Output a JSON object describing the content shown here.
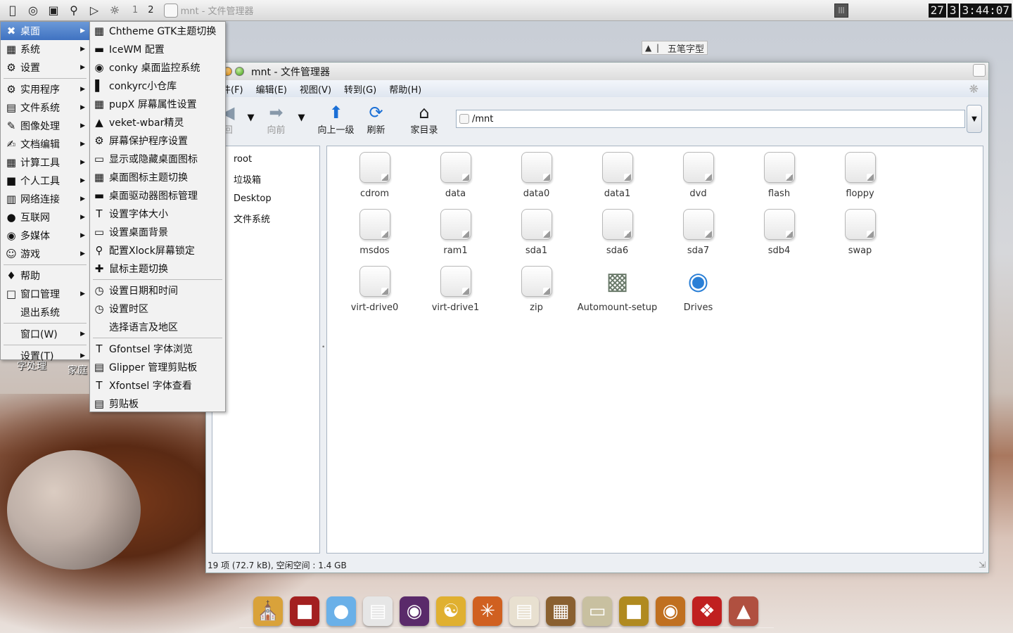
{
  "topbar": {
    "workspaces": [
      "1",
      "2"
    ],
    "task_title": "mnt - 文件管理器",
    "clock": {
      "date": "27",
      "month": "3",
      "time": "3:44:07"
    }
  },
  "ime": {
    "label": "五笔字型"
  },
  "start_menu": {
    "items": [
      {
        "label": "桌面",
        "icon": "desktop-icon",
        "submenu": true,
        "selected": true
      },
      {
        "label": "系统",
        "icon": "system-icon",
        "submenu": true
      },
      {
        "label": "设置",
        "icon": "settings-icon",
        "submenu": true
      },
      {
        "label": "实用程序",
        "icon": "utilities-icon",
        "submenu": true
      },
      {
        "label": "文件系统",
        "icon": "filesystem-icon",
        "submenu": true
      },
      {
        "label": "图像处理",
        "icon": "image-icon",
        "submenu": true
      },
      {
        "label": "文档编辑",
        "icon": "document-icon",
        "submenu": true
      },
      {
        "label": "计算工具",
        "icon": "calc-icon",
        "submenu": true
      },
      {
        "label": "个人工具",
        "icon": "personal-icon",
        "submenu": true
      },
      {
        "label": "网络连接",
        "icon": "network-icon",
        "submenu": true
      },
      {
        "label": "互联网",
        "icon": "internet-icon",
        "submenu": true
      },
      {
        "label": "多媒体",
        "icon": "multimedia-icon",
        "submenu": true
      },
      {
        "label": "游戏",
        "icon": "game-icon",
        "submenu": true
      },
      {
        "label": "帮助",
        "icon": "help-icon",
        "submenu": false
      },
      {
        "label": "窗口管理",
        "icon": "window-icon",
        "submenu": true
      },
      {
        "label": "退出系统",
        "icon": "",
        "submenu": false
      },
      {
        "label": "窗口(W)",
        "icon": "",
        "submenu": true
      },
      {
        "label": "设置(T)",
        "icon": "",
        "submenu": true
      }
    ]
  },
  "desktop_submenu": {
    "items": [
      {
        "label": "Chtheme  GTK主题切换",
        "icon": "theme-icon"
      },
      {
        "label": "IceWM 配置",
        "icon": "icewm-icon"
      },
      {
        "label": "conky 桌面监控系统",
        "icon": "conky-icon"
      },
      {
        "label": "conkyrc小仓库",
        "icon": "chart-icon"
      },
      {
        "label": "pupX 屏幕属性设置",
        "icon": "screen-settings-icon"
      },
      {
        "label": "veket-wbar精灵",
        "icon": "wbar-icon"
      },
      {
        "label": "屏幕保护程序设置",
        "icon": "screensaver-icon"
      },
      {
        "label": "显示或隐藏桌面图标",
        "icon": "monitor-icon"
      },
      {
        "label": "桌面图标主题切换",
        "icon": "icon-theme-icon"
      },
      {
        "label": "桌面驱动器图标管理",
        "icon": "drive-icon"
      },
      {
        "label": "设置字体大小",
        "icon": "font-icon"
      },
      {
        "label": "设置桌面背景",
        "icon": "wallpaper-icon"
      },
      {
        "label": "配置Xlock屏幕锁定",
        "icon": "lock-search-icon"
      },
      {
        "label": "鼠标主题切换",
        "icon": "mouse-theme-icon"
      },
      {
        "label": "设置日期和时间",
        "icon": "clock-icon"
      },
      {
        "label": "设置时区",
        "icon": "clock-icon"
      },
      {
        "label": "选择语言及地区",
        "icon": ""
      },
      {
        "label": "Gfontsel 字体浏览",
        "icon": "font-icon"
      },
      {
        "label": "Glipper 管理剪贴板",
        "icon": "clipboard-icon"
      },
      {
        "label": "Xfontsel 字体查看",
        "icon": "font-icon"
      },
      {
        "label": "剪贴板",
        "icon": "clipboard-icon"
      }
    ]
  },
  "desktop_labels": {
    "word": "字处理",
    "home": "家庭"
  },
  "file_manager": {
    "title": "mnt - 文件管理器",
    "menu": [
      "件(F)",
      "编辑(E)",
      "视图(V)",
      "转到(G)",
      "帮助(H)"
    ],
    "toolbar": {
      "back": "回",
      "forward": "向前",
      "up": "向上一级",
      "refresh": "刷新",
      "home": "家目录"
    },
    "address": "/mnt",
    "sidebar": [
      "root",
      "垃圾箱",
      "Desktop",
      "文件系统"
    ],
    "files": [
      {
        "name": "cdrom",
        "type": "folder"
      },
      {
        "name": "data",
        "type": "folder"
      },
      {
        "name": "data0",
        "type": "folder"
      },
      {
        "name": "data1",
        "type": "folder"
      },
      {
        "name": "dvd",
        "type": "folder"
      },
      {
        "name": "flash",
        "type": "folder"
      },
      {
        "name": "floppy",
        "type": "folder"
      },
      {
        "name": "msdos",
        "type": "folder"
      },
      {
        "name": "ram1",
        "type": "folder"
      },
      {
        "name": "sda1",
        "type": "folder"
      },
      {
        "name": "sda6",
        "type": "folder"
      },
      {
        "name": "sda7",
        "type": "folder"
      },
      {
        "name": "sdb4",
        "type": "folder"
      },
      {
        "name": "swap",
        "type": "folder"
      },
      {
        "name": "virt-drive0",
        "type": "folder"
      },
      {
        "name": "virt-drive1",
        "type": "folder"
      },
      {
        "name": "zip",
        "type": "folder"
      },
      {
        "name": "Automount-setup",
        "type": "device"
      },
      {
        "name": "Drives",
        "type": "drives"
      }
    ],
    "status": "19 项 (72.7 kB), 空闲空间 : 1.4 GB"
  },
  "dock": [
    "palace-icon",
    "flag-icon",
    "browser-icon",
    "papers-icon",
    "media-icon",
    "yinyang-icon",
    "fire-icon",
    "notebook-icon",
    "abacus-icon",
    "painting-icon",
    "treasure-icon",
    "bowl-icon",
    "knot-icon",
    "lamp-icon"
  ],
  "colors": {
    "menu_selected": "#3f72c1",
    "accent": "#1a6fd6"
  }
}
